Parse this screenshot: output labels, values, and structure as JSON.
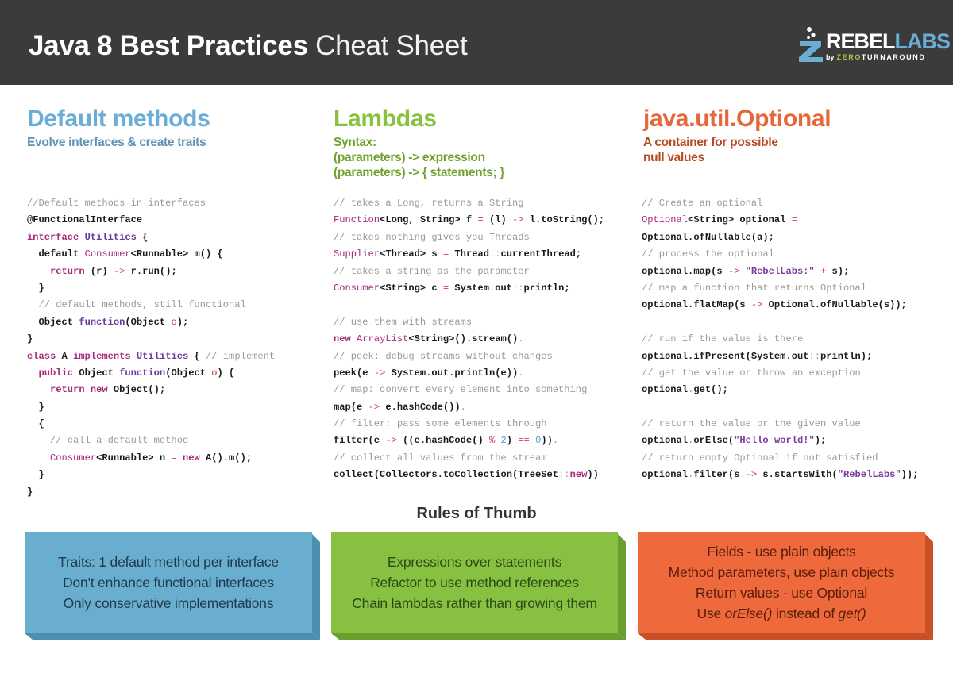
{
  "header": {
    "title_bold": "Java 8 Best Practices",
    "title_light": "Cheat Sheet",
    "logo": {
      "icon": "flask-icon",
      "word_rebel": "REBEL",
      "word_labs": "LABS",
      "sub_by": "by",
      "sub_zero": "ZERO",
      "sub_turnaround": "TURNAROUND"
    }
  },
  "colors": {
    "header_bg": "#3b3b3b",
    "blue": "#6aaed6",
    "green": "#86c13f",
    "orange": "#e8673a",
    "comment": "#9a9a9a",
    "keyword": "#a62a7c"
  },
  "sections": [
    {
      "title": "Default methods",
      "subtitle": "Evolve interfaces & create traits",
      "code": [
        [
          [
            "comment",
            "//Default methods in interfaces"
          ]
        ],
        [
          [
            "plain",
            "@FunctionalInterface"
          ]
        ],
        [
          [
            "keyword",
            "interface"
          ],
          [
            "plain",
            " "
          ],
          [
            "kwn",
            "Utilities"
          ],
          [
            "plain",
            " {"
          ]
        ],
        [
          [
            "plain",
            "  default "
          ],
          [
            "type",
            "Consumer"
          ],
          [
            "plain",
            "<Runnable> m() {"
          ]
        ],
        [
          [
            "plain",
            "    "
          ],
          [
            "keyword",
            "return"
          ],
          [
            "plain",
            " (r) "
          ],
          [
            "op",
            "->"
          ],
          [
            "plain",
            " r.run();"
          ]
        ],
        [
          [
            "plain",
            "  }"
          ]
        ],
        [
          [
            "comment",
            "  // default methods, still functional"
          ]
        ],
        [
          [
            "plain",
            "  Object "
          ],
          [
            "kwn",
            "function"
          ],
          [
            "plain",
            "(Object "
          ],
          [
            "param",
            "o"
          ],
          [
            "plain",
            ");"
          ]
        ],
        [
          [
            "plain",
            "}"
          ]
        ],
        [
          [
            "keyword",
            "class"
          ],
          [
            "plain",
            " A "
          ],
          [
            "keyword",
            "implements"
          ],
          [
            "plain",
            " "
          ],
          [
            "kwn",
            "Utilities"
          ],
          [
            "plain",
            " { "
          ],
          [
            "comment",
            "// implement"
          ]
        ],
        [
          [
            "plain",
            "  "
          ],
          [
            "keyword",
            "public"
          ],
          [
            "plain",
            " Object "
          ],
          [
            "kwn",
            "function"
          ],
          [
            "plain",
            "(Object "
          ],
          [
            "param",
            "o"
          ],
          [
            "plain",
            ") {"
          ]
        ],
        [
          [
            "plain",
            "    "
          ],
          [
            "keyword",
            "return"
          ],
          [
            "plain",
            " "
          ],
          [
            "keyword",
            "new"
          ],
          [
            "plain",
            " Object();"
          ]
        ],
        [
          [
            "plain",
            "  }"
          ]
        ],
        [
          [
            "plain",
            "  {"
          ]
        ],
        [
          [
            "comment",
            "    // call a default method"
          ]
        ],
        [
          [
            "plain",
            "    "
          ],
          [
            "type",
            "Consumer"
          ],
          [
            "plain",
            "<Runnable> n "
          ],
          [
            "op",
            "="
          ],
          [
            "plain",
            " "
          ],
          [
            "keyword",
            "new"
          ],
          [
            "plain",
            " A().m();"
          ]
        ],
        [
          [
            "plain",
            "  }"
          ]
        ],
        [
          [
            "plain",
            "}"
          ]
        ]
      ],
      "rules": [
        "Traits: 1 default method per interface",
        "Don't enhance functional interfaces",
        "Only conservative implementations"
      ]
    },
    {
      "title": "Lambdas",
      "subtitle": "Syntax:\n(parameters) -> expression\n(parameters) -> { statements; }",
      "code": [
        [
          [
            "comment",
            "// takes a Long, returns a String"
          ]
        ],
        [
          [
            "type",
            "Function"
          ],
          [
            "plain",
            "<Long, String> f "
          ],
          [
            "op",
            "="
          ],
          [
            "plain",
            " (l) "
          ],
          [
            "op",
            "->"
          ],
          [
            "plain",
            " l.toString();"
          ]
        ],
        [
          [
            "comment",
            "// takes nothing gives you Threads"
          ]
        ],
        [
          [
            "type",
            "Supplier"
          ],
          [
            "plain",
            "<Thread> s "
          ],
          [
            "op",
            "="
          ],
          [
            "plain",
            " Thread"
          ],
          [
            "dim",
            "::"
          ],
          [
            "plain",
            "currentThread;"
          ]
        ],
        [
          [
            "comment",
            "// takes a string as the parameter"
          ]
        ],
        [
          [
            "type",
            "Consumer"
          ],
          [
            "plain",
            "<String> c "
          ],
          [
            "op",
            "="
          ],
          [
            "plain",
            " System"
          ],
          [
            "dim",
            "."
          ],
          [
            "plain",
            "out"
          ],
          [
            "dim",
            "::"
          ],
          [
            "plain",
            "println;"
          ]
        ],
        [
          [
            "plain",
            ""
          ]
        ],
        [
          [
            "comment",
            "// use them with streams"
          ]
        ],
        [
          [
            "keyword",
            "new"
          ],
          [
            "plain",
            " "
          ],
          [
            "type",
            "ArrayList"
          ],
          [
            "plain",
            "<String>().stream()"
          ],
          [
            "dim",
            "."
          ]
        ],
        [
          [
            "comment",
            "// peek: debug streams without changes"
          ]
        ],
        [
          [
            "plain",
            "peek(e "
          ],
          [
            "op",
            "->"
          ],
          [
            "plain",
            " System.out.println(e))"
          ],
          [
            "dim",
            "."
          ]
        ],
        [
          [
            "comment",
            "// map: convert every element into something"
          ]
        ],
        [
          [
            "plain",
            "map(e "
          ],
          [
            "op",
            "->"
          ],
          [
            "plain",
            " e.hashCode())"
          ],
          [
            "dim",
            "."
          ]
        ],
        [
          [
            "comment",
            "// filter: pass some elements through"
          ]
        ],
        [
          [
            "plain",
            "filter(e "
          ],
          [
            "op",
            "->"
          ],
          [
            "plain",
            " ((e.hashCode() "
          ],
          [
            "op",
            "%"
          ],
          [
            "plain",
            " "
          ],
          [
            "num",
            "2"
          ],
          [
            "plain",
            ") "
          ],
          [
            "op",
            "=="
          ],
          [
            "plain",
            " "
          ],
          [
            "num",
            "0"
          ],
          [
            "plain",
            "))"
          ],
          [
            "dim",
            "."
          ]
        ],
        [
          [
            "comment",
            "// collect all values from the stream"
          ]
        ],
        [
          [
            "plain",
            "collect(Collectors.toCollection(TreeSet"
          ],
          [
            "dim",
            "::"
          ],
          [
            "keyword",
            "new"
          ],
          [
            "plain",
            "))"
          ]
        ]
      ],
      "rules": [
        "Expressions over statements",
        "Refactor to use method references",
        "Chain lambdas rather than growing them"
      ]
    },
    {
      "title": "java.util.Optional",
      "subtitle": "A container for possible\nnull values",
      "code": [
        [
          [
            "comment",
            "// Create an optional"
          ]
        ],
        [
          [
            "type",
            "Optional"
          ],
          [
            "plain",
            "<String> optional "
          ],
          [
            "op",
            "="
          ]
        ],
        [
          [
            "plain",
            "Optional.ofNullable(a);"
          ]
        ],
        [
          [
            "comment",
            "// process the optional"
          ]
        ],
        [
          [
            "plain",
            "optional.map(s "
          ],
          [
            "op",
            "->"
          ],
          [
            "plain",
            " "
          ],
          [
            "string",
            "\"RebelLabs:\""
          ],
          [
            "plain",
            " "
          ],
          [
            "op",
            "+"
          ],
          [
            "plain",
            " s);"
          ]
        ],
        [
          [
            "comment",
            "// map a function that returns Optional"
          ]
        ],
        [
          [
            "plain",
            "optional.flatMap(s "
          ],
          [
            "op",
            "->"
          ],
          [
            "plain",
            " Optional.ofNullable(s));"
          ]
        ],
        [
          [
            "plain",
            ""
          ]
        ],
        [
          [
            "comment",
            "// run if the value is there"
          ]
        ],
        [
          [
            "plain",
            "optional.ifPresent(System.out"
          ],
          [
            "dim",
            "::"
          ],
          [
            "plain",
            "println);"
          ]
        ],
        [
          [
            "comment",
            "// get the value or throw an exception"
          ]
        ],
        [
          [
            "plain",
            "optional"
          ],
          [
            "dim",
            "."
          ],
          [
            "plain",
            "get();"
          ]
        ],
        [
          [
            "plain",
            ""
          ]
        ],
        [
          [
            "comment",
            "// return the value or the given value"
          ]
        ],
        [
          [
            "plain",
            "optional"
          ],
          [
            "dim",
            "."
          ],
          [
            "plain",
            "orElse("
          ],
          [
            "string",
            "\"Hello world!\""
          ],
          [
            "plain",
            ");"
          ]
        ],
        [
          [
            "comment",
            "// return empty Optional if not satisfied"
          ]
        ],
        [
          [
            "plain",
            "optional"
          ],
          [
            "dim",
            "."
          ],
          [
            "plain",
            "filter(s "
          ],
          [
            "op",
            "->"
          ],
          [
            "plain",
            " s.startsWith("
          ],
          [
            "string",
            "\"RebelLabs\""
          ],
          [
            "plain",
            "));"
          ]
        ]
      ],
      "rules": [
        "Fields - use plain objects",
        "Method parameters, use plain objects",
        "Return values - use Optional",
        [
          [
            "text",
            "Use "
          ],
          [
            "italic",
            "orElse()"
          ],
          [
            "text",
            " instead of "
          ],
          [
            "italic",
            "get()"
          ]
        ]
      ]
    }
  ],
  "rules_title": "Rules of Thumb"
}
